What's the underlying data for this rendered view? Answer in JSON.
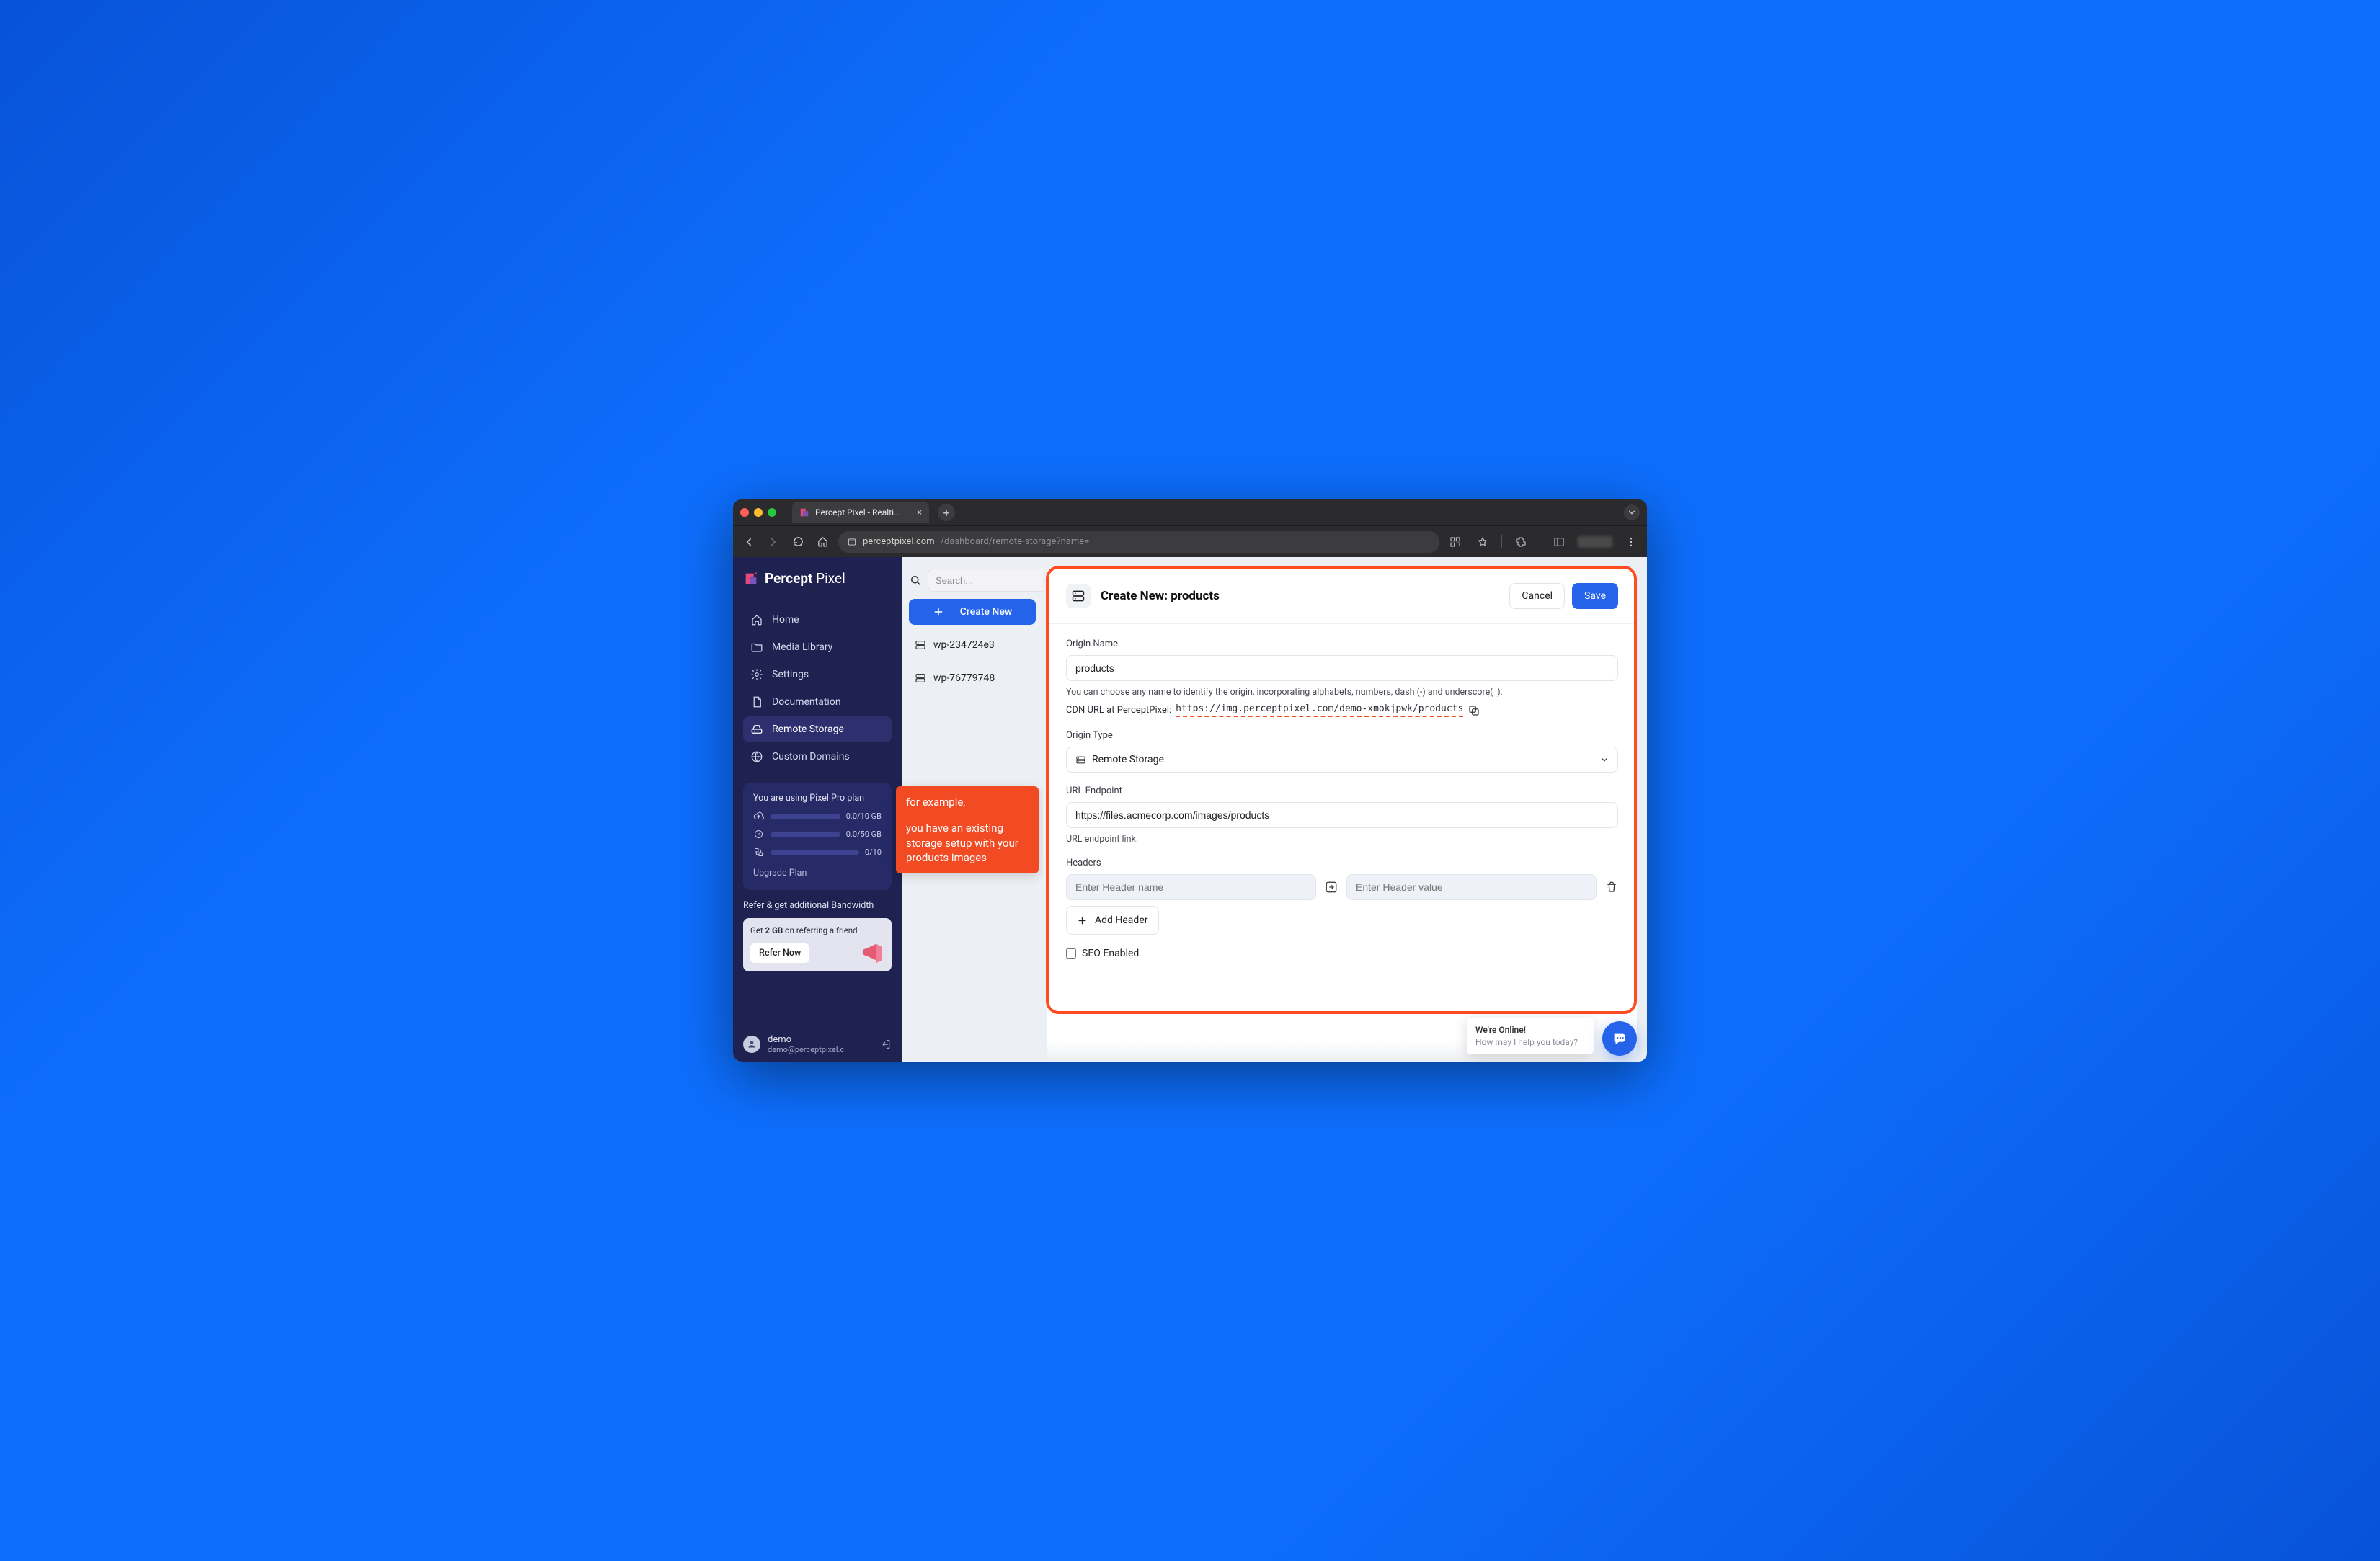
{
  "browser": {
    "tab_title": "Percept Pixel - Realtime Ima…",
    "url_host": "perceptpixel.com",
    "url_path": "/dashboard/remote-storage?name="
  },
  "brand": {
    "name_bold": "Percept",
    "name_light": "Pixel"
  },
  "sidebar": {
    "items": [
      {
        "label": "Home"
      },
      {
        "label": "Media Library"
      },
      {
        "label": "Settings"
      },
      {
        "label": "Documentation"
      },
      {
        "label": "Remote Storage"
      },
      {
        "label": "Custom Domains"
      }
    ],
    "plan": {
      "heading": "You are using Pixel Pro plan",
      "rows": [
        {
          "value": "0.0/10 GB"
        },
        {
          "value": "0.0/50 GB"
        },
        {
          "value": "0/10"
        }
      ],
      "upgrade": "Upgrade Plan"
    },
    "refer": {
      "title": "Refer & get additional Bandwidth",
      "blurb_prefix": "Get ",
      "blurb_bold": "2 GB",
      "blurb_suffix": " on referring a friend",
      "button": "Refer Now"
    },
    "user": {
      "name": "demo",
      "email": "demo@perceptpixel.c"
    }
  },
  "middle": {
    "search_placeholder": "Search...",
    "create": "Create New",
    "items": [
      {
        "name": "wp-234724e3"
      },
      {
        "name": "wp-76779748"
      }
    ]
  },
  "annotation": {
    "line1": "for example,",
    "line2": "you have an existing storage setup with your products images"
  },
  "form": {
    "title": "Create New: products",
    "cancel": "Cancel",
    "save": "Save",
    "origin_name_label": "Origin Name",
    "origin_name_value": "products",
    "origin_name_hint": "You can choose any name to identify the origin, incorporating alphabets, numbers, dash (-) and underscore(_).",
    "cdn_label": "CDN URL at PerceptPixel:",
    "cdn_url": "https://img.perceptpixel.com/demo-xmokjpwk/products",
    "origin_type_label": "Origin Type",
    "origin_type_value": "Remote Storage",
    "url_endpoint_label": "URL Endpoint",
    "url_endpoint_value": "https://files.acmecorp.com/images/products",
    "url_endpoint_hint": "URL endpoint link.",
    "headers_label": "Headers",
    "header_name_placeholder": "Enter Header name",
    "header_value_placeholder": "Enter Header value",
    "add_header": "Add Header",
    "seo_label": "SEO Enabled"
  },
  "chat": {
    "title": "We're Online!",
    "subtitle": "How may I help you today?"
  }
}
